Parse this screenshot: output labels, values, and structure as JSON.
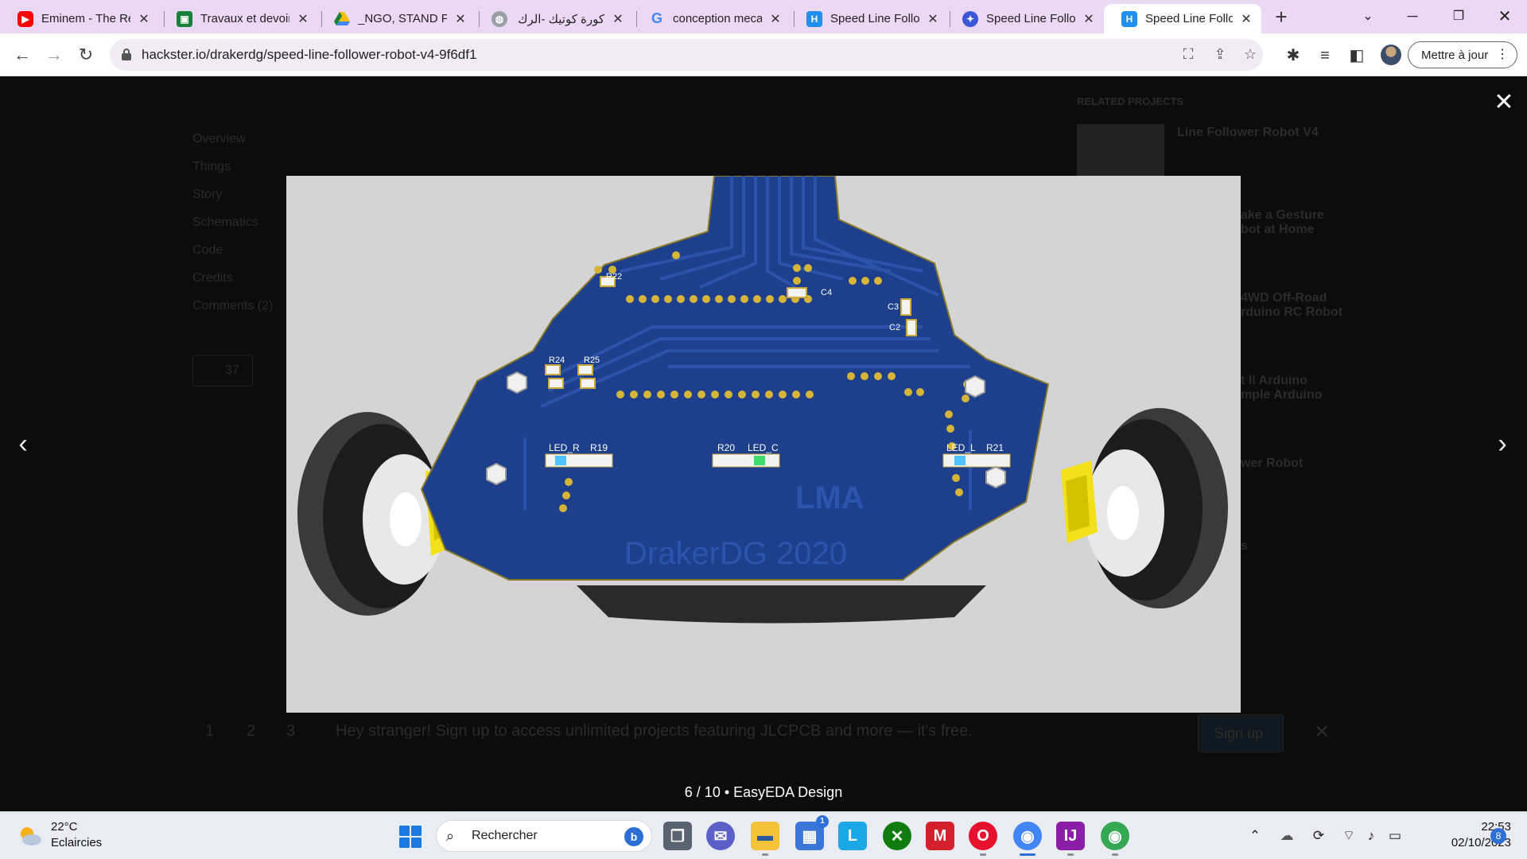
{
  "browser": {
    "tabs": [
      {
        "title": "Eminem - The Real Slim Shady",
        "favicon": "youtube-icon",
        "color": "#ff0000"
      },
      {
        "title": "Travaux et devoirs",
        "favicon": "classroom-icon",
        "color": "#188038"
      },
      {
        "title": "_NGO, STAND FOR",
        "favicon": "drive-icon",
        "color": "#fbbc04"
      },
      {
        "title": "كورة كوتيك -الرك",
        "favicon": "globe-icon",
        "color": "#888888"
      },
      {
        "title": "conception mecanique",
        "favicon": "google-icon",
        "color": "#4285f4"
      },
      {
        "title": "Speed Line Follower",
        "favicon": "hackster-icon",
        "color": "#1f8ef1"
      },
      {
        "title": "Speed Line Follower",
        "favicon": "easyeda-icon",
        "color": "#3b57d8"
      },
      {
        "title": "Speed Line Follower",
        "favicon": "hackster-icon",
        "color": "#1f8ef1",
        "active": true
      }
    ],
    "url": "hackster.io/drakerdg/speed-line-follower-robot-v4-9f6df1",
    "update_label": "Mettre à jour"
  },
  "page": {
    "sidebar_nav": [
      "Overview",
      "Things",
      "Story",
      "Schematics",
      "Code",
      "Credits",
      "Comments (2)"
    ],
    "like_count": "37",
    "related_title": "RELATED PROJECTS",
    "related": [
      "Line Follower Robot V4",
      "ake a Gesture\nbot at Home",
      "4WD Off-Road\nrduino RC Robot",
      "t ll Arduino\nmple Arduino",
      "wer Robot",
      "s"
    ],
    "pager": [
      "1",
      "2",
      "3"
    ],
    "banner_text": "Hey stranger! Sign up to access unlimited projects featuring JLCPCB and more — it's free.",
    "signup_label": "Sign up"
  },
  "lightbox": {
    "caption": "6 / 10 • EasyEDA Design",
    "pcb": {
      "silkscreen_text": "DrakerDG 2020",
      "logo_text": "LMA",
      "labels": [
        "R22",
        "C4",
        "C3",
        "C2",
        "R24",
        "R25",
        "LED_R",
        "R19",
        "R20",
        "LED_C",
        "LED_L",
        "R21"
      ]
    }
  },
  "taskbar": {
    "weather_temp": "22°C",
    "weather_desc": "Eclaircies",
    "search_placeholder": "Rechercher",
    "time": "22:53",
    "date": "02/10/2023",
    "notification_count": "8",
    "store_badge": "1"
  }
}
